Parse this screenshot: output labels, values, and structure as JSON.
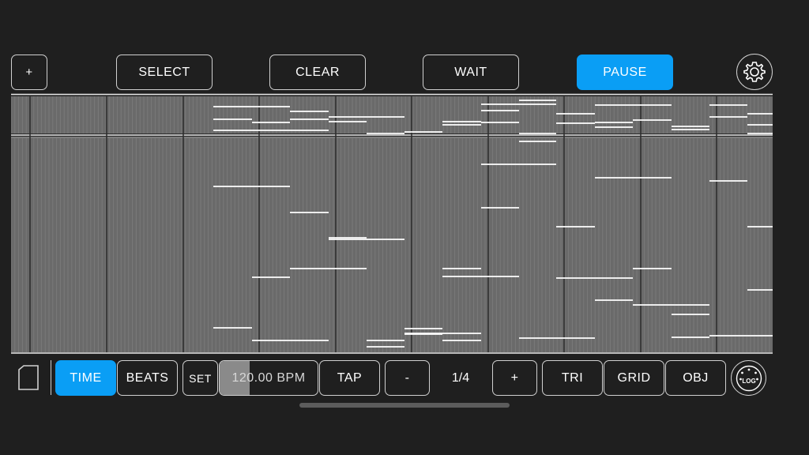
{
  "toolbar": {
    "add_label": "+",
    "select_label": "SELECT",
    "clear_label": "CLEAR",
    "wait_label": "WAIT",
    "pause_label": "PAUSE",
    "settings_icon": "gear-icon"
  },
  "bottom_bar": {
    "file_icon": "document-icon",
    "time_label": "TIME",
    "beats_label": "BEATS",
    "set_label": "SET",
    "bpm_label": "120.00 BPM",
    "tap_label": "TAP",
    "minus_label": "-",
    "division_label": "1/4",
    "plus_label": "+",
    "tri_label": "TRI",
    "grid_label": "GRID",
    "obj_label": "OBJ",
    "log_label": "LOG",
    "log_icon": "midi-log-icon",
    "active_mode": "TIME"
  },
  "colors": {
    "accent": "#0a9ef5",
    "background": "#1f1f1f",
    "grid_fill": "#6b6b6b",
    "note_line": "#ffffff"
  }
}
